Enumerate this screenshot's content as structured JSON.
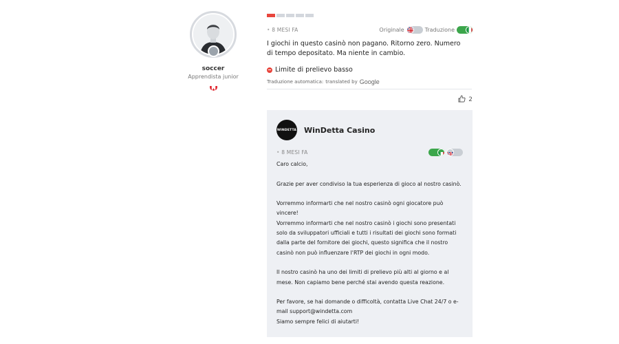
{
  "user": {
    "name": "soccer",
    "rank": "Apprendista junior"
  },
  "review": {
    "rating_filled": 1,
    "rating_total": 5,
    "date": "8 MESI FA",
    "original_label": "Originale",
    "translation_label": "Traduzione",
    "text": "I giochi in questo casinò non pagano. Ritorno zero. Numero di tempo depositato. Ma niente in cambio.",
    "tag": "Limite di prelievo basso",
    "auto_translation": "Traduzione automatica:",
    "translated_by": "translated by",
    "google": "Google",
    "likes": "2"
  },
  "reply": {
    "logo_text": "WINDETTA",
    "casino_name": "WinDetta Casino",
    "date": "8 MESI FA",
    "greeting": "Caro calcio,",
    "p1": "Grazie per aver condiviso la tua esperienza di gioco al nostro casinò.",
    "p2a": "Vorremmo informarti che nel nostro casinò ogni giocatore può vincere!",
    "p2b": "Vorremmo informarti che nel nostro casinò i giochi sono presentati solo da sviluppatori ufficiali e tutti i risultati dei giochi sono formati dalla parte del fornitore dei giochi, questo significa che il nostro casinò non può influenzare l'RTP dei giochi in ogni modo.",
    "p3": "Il nostro casinò ha uno dei limiti di prelievo più alti al giorno e al mese. Non capiamo bene perché stai avendo questa reazione.",
    "p4a": "Per favore, se hai domande o difficoltà, contatta Live Chat 24/7 o e-mail support@windetta.com",
    "p4b": "Siamo sempre felici di aiutarti!"
  },
  "colors": {
    "accent_red": "#e8453c",
    "toggle_green": "#3ca64b",
    "reply_bg": "#eef0f4"
  },
  "icons": [
    "avatar-icon",
    "canada-flag-icon",
    "uk-flag-icon",
    "italy-flag-icon",
    "minus-circle-icon",
    "thumbs-up-icon"
  ]
}
